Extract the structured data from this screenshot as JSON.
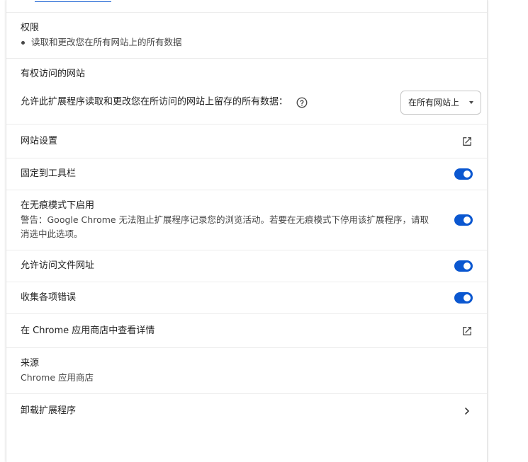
{
  "permissions": {
    "title": "权限",
    "items": [
      "读取和更改您在所有网站上的所有数据"
    ]
  },
  "site_access": {
    "title": "有权访问的网站",
    "description": "允许此扩展程序读取和更改您在所访问的网站上留存的所有数据：",
    "select_value": "在所有网站上"
  },
  "site_settings": {
    "label": "网站设置",
    "icon": "open-in-new-icon"
  },
  "pin_toolbar": {
    "label": "固定到工具栏",
    "enabled": true
  },
  "incognito": {
    "label": "在无痕模式下启用",
    "warning": "警告：Google Chrome 无法阻止扩展程序记录您的浏览活动。若要在无痕模式下停用该扩展程序，请取消选中此选项。",
    "enabled": true
  },
  "file_urls": {
    "label": "允许访问文件网址",
    "enabled": true
  },
  "collect_errors": {
    "label": "收集各项错误",
    "enabled": true
  },
  "webstore": {
    "label": "在 Chrome 应用商店中查看详情",
    "icon": "open-in-new-icon"
  },
  "source": {
    "label": "来源",
    "value": "Chrome 应用商店"
  },
  "uninstall": {
    "label": "卸载扩展程序",
    "icon": "chevron-right-icon"
  },
  "colors": {
    "toggle_on": "#0b57d0",
    "divider": "#ececec",
    "text_primary": "#1f1f1f",
    "text_secondary": "#474747"
  }
}
